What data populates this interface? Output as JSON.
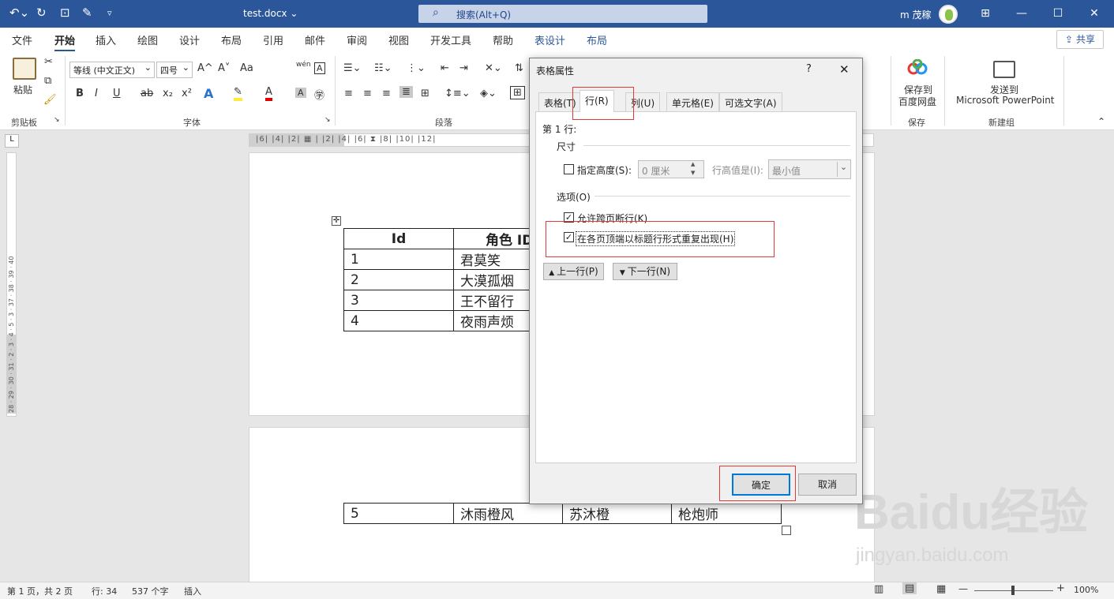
{
  "titlebar": {
    "doc_title": "test.docx ⌄",
    "search_placeholder": "搜索(Alt+Q)",
    "user": "m 茂稼"
  },
  "menu": [
    "文件",
    "开始",
    "插入",
    "绘图",
    "设计",
    "布局",
    "引用",
    "邮件",
    "审阅",
    "视图",
    "开发工具",
    "帮助",
    "表设计",
    "布局"
  ],
  "share": "共享",
  "ribbon": {
    "paste": "粘贴",
    "clipboard": "剪贴板",
    "font_name": "等线 (中文正文)",
    "font_size": "四号",
    "font": "字体",
    "paragraph": "段落",
    "save_to": "保存到",
    "baidu_disk": "百度网盘",
    "save": "保存",
    "send_to": "发送到",
    "ppt": "Microsoft PowerPoint",
    "new_group": "新建组",
    "bold": "B",
    "italic": "I",
    "underline": "U",
    "strike": "ab",
    "sub": "x₂",
    "sup": "x²",
    "grow": "A^",
    "shrink": "A˅",
    "case": "Aa",
    "pinyin": "wén",
    "box": "A"
  },
  "ruler": {
    "h": "|6|  |4|  |2|  ▦  |  |2|  |4|  |6|  ⧗ |8|  |10|  |12|",
    "v": "28 · 29 · 30 · 31 · 2 · 3 · 4 · 5 · 3 · 37 · 38 · 39 · 40"
  },
  "table1": {
    "header": [
      "Id",
      "角色 ID"
    ],
    "rows": [
      [
        "1",
        "君莫笑"
      ],
      [
        "2",
        "大漠孤烟"
      ],
      [
        "3",
        "王不留行"
      ],
      [
        "4",
        "夜雨声烦"
      ]
    ]
  },
  "table2": {
    "rows": [
      [
        "5",
        "沐雨橙风",
        "苏沐橙",
        "枪炮师"
      ]
    ]
  },
  "dialog": {
    "title": "表格属性",
    "help": "?",
    "close": "✕",
    "tabs": [
      "表格(T)",
      "行(R)",
      "列(U)",
      "单元格(E)",
      "可选文字(A)"
    ],
    "row_label": "第 1 行:",
    "size": "尺寸",
    "specify_height": "指定高度(S):",
    "height_value": "0 厘米",
    "height_is": "行高值是(I):",
    "height_mode": "最小值",
    "options": "选项(O)",
    "allow_break": "允许跨页断行(K)",
    "repeat_header": "在各页顶端以标题行形式重复出现(H)",
    "prev_row": "上一行(P)",
    "next_row": "下一行(N)",
    "ok": "确定",
    "cancel": "取消"
  },
  "status": {
    "page": "第 1 页，共 2 页",
    "row": "行: 34",
    "chars": "537 个字",
    "insert": "插入",
    "zoom": "100%"
  },
  "watermark": {
    "logo": "Baidu经验",
    "url": "jingyan.baidu.com"
  }
}
